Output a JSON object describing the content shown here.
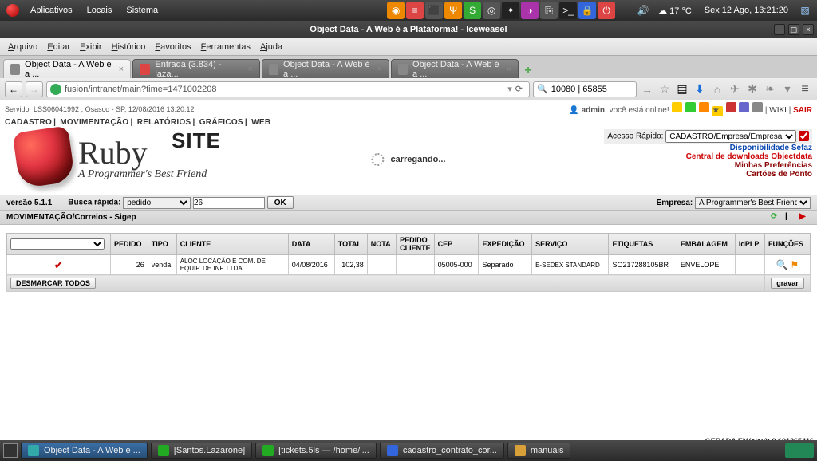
{
  "gnome": {
    "menus": [
      "Aplicativos",
      "Locais",
      "Sistema"
    ],
    "weather": "17 °C",
    "clock": "Sex 12 Ago, 13:21:20"
  },
  "window": {
    "title": "Object Data - A Web é a Plataforma! - Iceweasel"
  },
  "browser_menu": [
    "Arquivo",
    "Editar",
    "Exibir",
    "Histórico",
    "Favoritos",
    "Ferramentas",
    "Ajuda"
  ],
  "tabs": [
    {
      "label": "Object Data - A Web é a ...",
      "active": true
    },
    {
      "label": "Entrada (3.834) - laza...",
      "active": false
    },
    {
      "label": "Object Data - A Web é a ...",
      "active": false
    },
    {
      "label": "Object Data - A Web é a ...",
      "active": false
    }
  ],
  "nav": {
    "url": "fusion/intranet/main?time=1471002208",
    "search": "10080 | 65855"
  },
  "srv": "Servidor LSS06041992 , Osasco - SP, 12/08/2016 13:20:12",
  "topmenu": [
    "CADASTRO",
    "MOVIMENTAÇÃO",
    "RELATÓRIOS",
    "GRÁFICOS",
    "WEB"
  ],
  "user": {
    "name": "admin",
    "status": ", você está online!",
    "wiki": "WIKI",
    "sair": "SAIR"
  },
  "ruby": {
    "title": "Ruby",
    "subtitle": "A Programmer's Best Friend",
    "site": "SITE"
  },
  "loading": "carregando...",
  "qa": {
    "label": "Acesso Rápido:",
    "select": "CADASTRO/Empresa/Empresa",
    "links": [
      {
        "t": "Disponibilidade Sefaz",
        "c": "qa-blue"
      },
      {
        "t": "Central de downloads Objectdata",
        "c": "qa-red"
      },
      {
        "t": "Minhas Preferências",
        "c": "qa-darkred"
      },
      {
        "t": "Cartões de Ponto",
        "c": "qa-darkred"
      }
    ]
  },
  "vbar": {
    "version": "versão 5.1.1",
    "busca_label": "Busca rápida:",
    "sel": "pedido",
    "input": "26",
    "ok": "OK",
    "empresa_label": "Empresa:",
    "empresa": "A Programmer's Best Friend"
  },
  "breadcrumb": "MOVIMENTAÇÃO/Correios - Sigep",
  "table": {
    "headers": [
      "",
      "PEDIDO",
      "TIPO",
      "CLIENTE",
      "DATA",
      "TOTAL",
      "NOTA",
      "PEDIDO CLIENTE",
      "CEP",
      "EXPEDIÇÃO",
      "SERVIÇO",
      "ETIQUETAS",
      "EMBALAGEM",
      "IdPLP",
      "FUNÇÕES"
    ],
    "row": {
      "pedido": "26",
      "tipo": "venda",
      "cliente": "ALOC LOCAÇÃO E COM. DE EQUIP. DE INF. LTDA",
      "data": "04/08/2016",
      "total": "102,38",
      "nota": "",
      "pedido_cliente": "",
      "cep": "05005-000",
      "expedicao": "Separado",
      "servico": "E-SEDEX STANDARD",
      "etiquetas": "SO217288105BR",
      "embalagem": "ENVELOPE",
      "idplp": ""
    },
    "desmarcar": "DESMARCAR TODOS",
    "gravar": "gravar"
  },
  "footer": "GERADA EM(ajax): 0.601365416",
  "taskbar": [
    {
      "label": "Object Data - A Web é ...",
      "cls": "tb-teal",
      "active": true
    },
    {
      "label": "[Santos.Lazarone]",
      "cls": "tb-green"
    },
    {
      "label": "[tickets.5ls — /home/l...",
      "cls": "tb-green"
    },
    {
      "label": "cadastro_contrato_cor...",
      "cls": "tb-blue"
    },
    {
      "label": "manuais",
      "cls": "tb-folder"
    }
  ]
}
